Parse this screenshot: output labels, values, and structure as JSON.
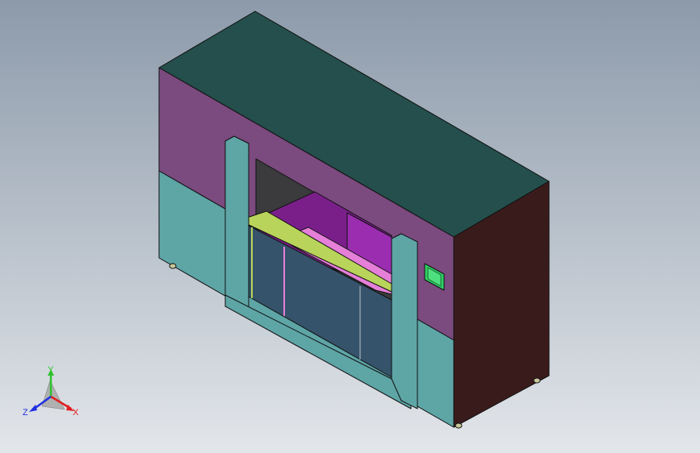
{
  "viewport": {
    "background_top": "#8c9aaa",
    "background_bottom": "#e3e6ea"
  },
  "model": {
    "colors": {
      "top": "#244f4c",
      "front_upper": "#7b4a7e",
      "front_lower": "#5ea5a6",
      "side": "#3a1b1c",
      "door_frame": "#5ea5a6",
      "window_glass": "#35536a",
      "chamber_interior": "#7a1f8a",
      "tray": "#e57fd8",
      "handle_trim": "#b9d45a",
      "control_panel": "#2fd064",
      "outline": "#111111"
    }
  },
  "triad": {
    "y_label": "Y",
    "x_label": "X",
    "z_label": "Z",
    "y_color": "#2ec22e",
    "x_color": "#e02020",
    "z_color": "#2030e0"
  }
}
